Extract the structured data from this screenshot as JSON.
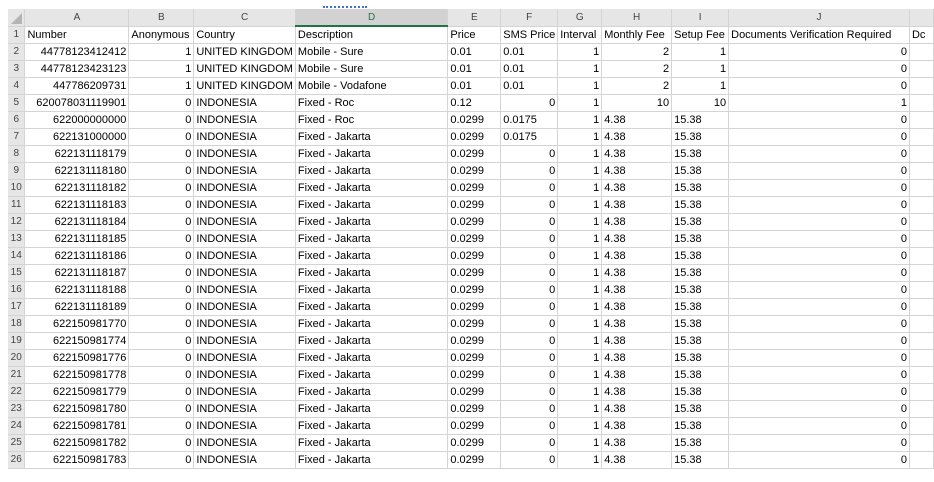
{
  "sheet": {
    "columns": [
      "A",
      "B",
      "C",
      "D",
      "E",
      "F",
      "G",
      "H",
      "I",
      "J"
    ],
    "partial_column_text": "Dc",
    "header": {
      "row_number": "1",
      "cells": [
        "Number",
        "Anonymous",
        "Country",
        "Description",
        "Price",
        "SMS Price",
        "Interval",
        "Monthly Fee",
        "Setup Fee",
        "Documents Verification Required"
      ]
    },
    "rows": [
      {
        "n": "2",
        "cells": [
          "44778123412412",
          "1",
          "UNITED KINGDOM",
          "Mobile - Sure",
          "0.01",
          "0.01",
          "1",
          "2",
          "1",
          "0"
        ]
      },
      {
        "n": "3",
        "cells": [
          "44778123423123",
          "1",
          "UNITED KINGDOM",
          "Mobile - Sure",
          "0.01",
          "0.01",
          "1",
          "2",
          "1",
          "0"
        ]
      },
      {
        "n": "4",
        "cells": [
          "447786209731",
          "1",
          "UNITED KINGDOM",
          "Mobile - Vodafone",
          "0.01",
          "0.01",
          "1",
          "2",
          "1",
          "0"
        ]
      },
      {
        "n": "5",
        "cells": [
          "620078031119901",
          "0",
          "INDONESIA",
          "Fixed - Roc",
          "0.12",
          "0",
          "1",
          "10",
          "10",
          "1"
        ]
      },
      {
        "n": "6",
        "cells": [
          "622000000000",
          "0",
          "INDONESIA",
          "Fixed - Roc",
          "0.0299",
          "0.0175",
          "1",
          "4.38",
          "15.38",
          "0"
        ]
      },
      {
        "n": "7",
        "cells": [
          "622131000000",
          "0",
          "INDONESIA",
          "Fixed - Jakarta",
          "0.0299",
          "0.0175",
          "1",
          "4.38",
          "15.38",
          "0"
        ]
      },
      {
        "n": "8",
        "cells": [
          "622131118179",
          "0",
          "INDONESIA",
          "Fixed - Jakarta",
          "0.0299",
          "0",
          "1",
          "4.38",
          "15.38",
          "0"
        ]
      },
      {
        "n": "9",
        "cells": [
          "622131118180",
          "0",
          "INDONESIA",
          "Fixed - Jakarta",
          "0.0299",
          "0",
          "1",
          "4.38",
          "15.38",
          "0"
        ]
      },
      {
        "n": "10",
        "cells": [
          "622131118182",
          "0",
          "INDONESIA",
          "Fixed - Jakarta",
          "0.0299",
          "0",
          "1",
          "4.38",
          "15.38",
          "0"
        ]
      },
      {
        "n": "11",
        "cells": [
          "622131118183",
          "0",
          "INDONESIA",
          "Fixed - Jakarta",
          "0.0299",
          "0",
          "1",
          "4.38",
          "15.38",
          "0"
        ]
      },
      {
        "n": "12",
        "cells": [
          "622131118184",
          "0",
          "INDONESIA",
          "Fixed - Jakarta",
          "0.0299",
          "0",
          "1",
          "4.38",
          "15.38",
          "0"
        ]
      },
      {
        "n": "13",
        "cells": [
          "622131118185",
          "0",
          "INDONESIA",
          "Fixed - Jakarta",
          "0.0299",
          "0",
          "1",
          "4.38",
          "15.38",
          "0"
        ]
      },
      {
        "n": "14",
        "cells": [
          "622131118186",
          "0",
          "INDONESIA",
          "Fixed - Jakarta",
          "0.0299",
          "0",
          "1",
          "4.38",
          "15.38",
          "0"
        ]
      },
      {
        "n": "15",
        "cells": [
          "622131118187",
          "0",
          "INDONESIA",
          "Fixed - Jakarta",
          "0.0299",
          "0",
          "1",
          "4.38",
          "15.38",
          "0"
        ]
      },
      {
        "n": "16",
        "cells": [
          "622131118188",
          "0",
          "INDONESIA",
          "Fixed - Jakarta",
          "0.0299",
          "0",
          "1",
          "4.38",
          "15.38",
          "0"
        ]
      },
      {
        "n": "17",
        "cells": [
          "622131118189",
          "0",
          "INDONESIA",
          "Fixed - Jakarta",
          "0.0299",
          "0",
          "1",
          "4.38",
          "15.38",
          "0"
        ]
      },
      {
        "n": "18",
        "cells": [
          "622150981770",
          "0",
          "INDONESIA",
          "Fixed - Jakarta",
          "0.0299",
          "0",
          "1",
          "4.38",
          "15.38",
          "0"
        ]
      },
      {
        "n": "19",
        "cells": [
          "622150981774",
          "0",
          "INDONESIA",
          "Fixed - Jakarta",
          "0.0299",
          "0",
          "1",
          "4.38",
          "15.38",
          "0"
        ]
      },
      {
        "n": "20",
        "cells": [
          "622150981776",
          "0",
          "INDONESIA",
          "Fixed - Jakarta",
          "0.0299",
          "0",
          "1",
          "4.38",
          "15.38",
          "0"
        ]
      },
      {
        "n": "21",
        "cells": [
          "622150981778",
          "0",
          "INDONESIA",
          "Fixed - Jakarta",
          "0.0299",
          "0",
          "1",
          "4.38",
          "15.38",
          "0"
        ]
      },
      {
        "n": "22",
        "cells": [
          "622150981779",
          "0",
          "INDONESIA",
          "Fixed - Jakarta",
          "0.0299",
          "0",
          "1",
          "4.38",
          "15.38",
          "0"
        ]
      },
      {
        "n": "23",
        "cells": [
          "622150981780",
          "0",
          "INDONESIA",
          "Fixed - Jakarta",
          "0.0299",
          "0",
          "1",
          "4.38",
          "15.38",
          "0"
        ]
      },
      {
        "n": "24",
        "cells": [
          "622150981781",
          "0",
          "INDONESIA",
          "Fixed - Jakarta",
          "0.0299",
          "0",
          "1",
          "4.38",
          "15.38",
          "0"
        ]
      },
      {
        "n": "25",
        "cells": [
          "622150981782",
          "0",
          "INDONESIA",
          "Fixed - Jakarta",
          "0.0299",
          "0",
          "1",
          "4.38",
          "15.38",
          "0"
        ]
      },
      {
        "n": "26",
        "cells": [
          "622150981783",
          "0",
          "INDONESIA",
          "Fixed - Jakarta",
          "0.0299",
          "0",
          "1",
          "4.38",
          "15.38",
          "0"
        ]
      }
    ]
  }
}
